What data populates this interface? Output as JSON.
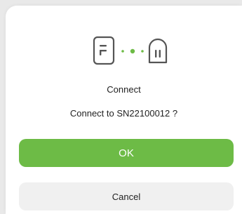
{
  "dialog": {
    "title": "Connect",
    "message": "Connect to SN22100012 ?",
    "ok_label": "OK",
    "cancel_label": "Cancel"
  },
  "icons": {
    "left": "phone-icon",
    "middle": "connection-dots-icon",
    "right": "device-icon"
  },
  "colors": {
    "accent": "#6dbb46",
    "icon_stroke": "#555555",
    "dot": "#6dbb46",
    "cancel_bg": "#f0f0f0",
    "background": "#e9e9e9"
  }
}
